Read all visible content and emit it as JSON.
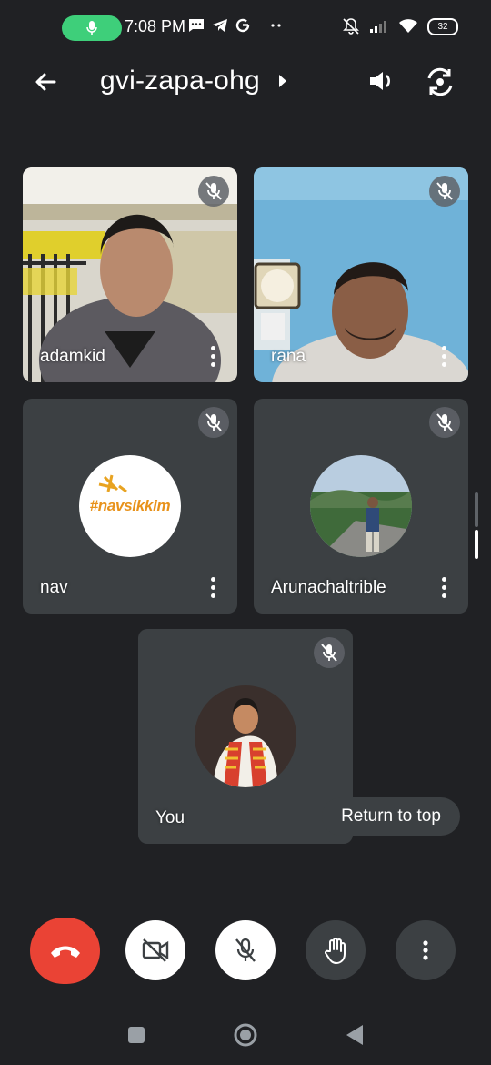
{
  "status_bar": {
    "time": "7:08 PM",
    "icons": [
      "mic-active-icon",
      "message-icon",
      "telegram-icon",
      "google-icon",
      "more-dots-icon"
    ],
    "right_icons": [
      "notifications-off-icon",
      "signal-icon",
      "wifi-icon"
    ],
    "battery": "32",
    "mic_pill_color": "#3ecf7a"
  },
  "header": {
    "meeting_code": "gvi-zapa-ohg",
    "icons": [
      "back-arrow-icon",
      "caret-right-icon",
      "speaker-icon",
      "switch-camera-icon"
    ]
  },
  "participants": [
    {
      "name": "adamkid",
      "muted": true,
      "media": "video"
    },
    {
      "name": "rana",
      "muted": true,
      "media": "video"
    },
    {
      "name": "nav",
      "muted": true,
      "media": "avatar",
      "avatar_text": "#navsikkim"
    },
    {
      "name": "Arunachaltrible",
      "muted": true,
      "media": "avatar"
    },
    {
      "name": "You",
      "muted": true,
      "media": "avatar"
    }
  ],
  "return_to_top": "Return to top",
  "controls": [
    {
      "name": "end-call",
      "icon": "phone-hangup-icon",
      "color": "#ea4335"
    },
    {
      "name": "camera",
      "icon": "camera-off-icon",
      "state": "off"
    },
    {
      "name": "microphone",
      "icon": "mic-off-icon",
      "state": "off"
    },
    {
      "name": "raise-hand",
      "icon": "hand-icon"
    },
    {
      "name": "more-options",
      "icon": "more-vert-icon"
    }
  ],
  "nav_bar": [
    "recents-square-icon",
    "home-circle-icon",
    "back-triangle-icon"
  ],
  "colors": {
    "background": "#202124",
    "tile": "#3c4043",
    "end_call": "#ea4335",
    "accent_green": "#3ecf7a"
  }
}
